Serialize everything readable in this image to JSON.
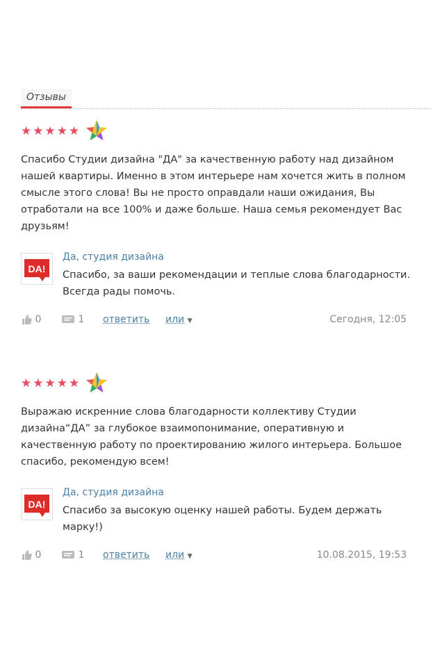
{
  "section": {
    "title": "Отзывы"
  },
  "reviews": [
    {
      "stars": "★★★★★",
      "text": "Спасибо Студии дизайна \"ДА\" за качественную работу над дизайном нашей квартиры. Именно в этом интерьере нам хочется жить в полном смысле этого слова! Вы не просто оправдали наши ожидания, Вы отработали на все 100% и даже больше. Наша семья рекомендует Вас друзьям!",
      "reply": {
        "author": "Да, студия дизайна",
        "avatar_text": "DA!",
        "text": "Спасибо, за ваши рекомендации и теплые слова благодарности. Всегда рады помочь."
      },
      "likes": "0",
      "comments": "1",
      "reply_label": "ответить",
      "more_label": "или",
      "date": "Сегодня, 12:05"
    },
    {
      "stars": "★★★★★",
      "text": "Выражаю искренние слова благодарности коллективу Студии дизайна“ДА” за глубокое взаимопонимание, оперативную и качественную работу по проектированию жилого интерьера. Большое спасибо, рекомендую всем!",
      "reply": {
        "author": "Да, студия дизайна",
        "avatar_text": "DA!",
        "text": "Спасибо за высокую оценку нашей работы. Будем держать марку!)"
      },
      "likes": "0",
      "comments": "1",
      "reply_label": "ответить",
      "more_label": "или",
      "date": "10.08.2015, 19:53"
    }
  ]
}
